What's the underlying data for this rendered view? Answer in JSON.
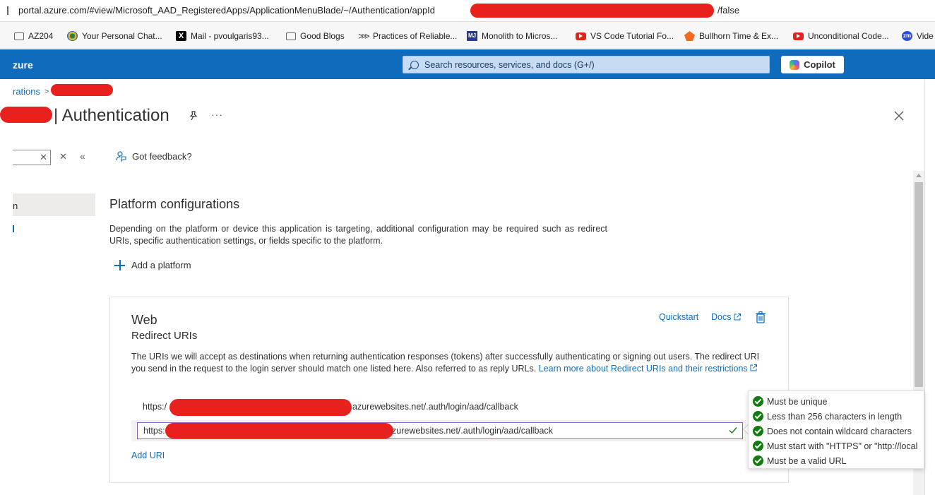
{
  "browser": {
    "url_start": "portal.azure.com/#view/Microsoft_AAD_RegisteredApps/ApplicationMenuBlade/~/Authentication/appId",
    "url_end": "/false"
  },
  "bookmarks": [
    {
      "label": "AZ204",
      "icon": "folder-icon"
    },
    {
      "label": "Your Personal Chat...",
      "icon": "chat-icon"
    },
    {
      "label": "Mail - pvoulgaris93...",
      "icon": "x-icon"
    },
    {
      "label": "Good Blogs",
      "icon": "folder-icon"
    },
    {
      "label": "Practices of Reliable...",
      "icon": "link-icon"
    },
    {
      "label": "Monolith to Micros...",
      "icon": "mj-icon"
    },
    {
      "label": "VS Code Tutorial Fo...",
      "icon": "youtube-icon"
    },
    {
      "label": "Bullhorn Time & Ex...",
      "icon": "bullhorn-icon"
    },
    {
      "label": "Unconditional Code...",
      "icon": "youtube-icon"
    },
    {
      "label": "Vide",
      "icon": "zm-icon"
    }
  ],
  "topbar": {
    "brand": "zure",
    "search_placeholder": "Search resources, services, and docs (G+/)",
    "copilot_label": "Copilot"
  },
  "breadcrumb": {
    "parent": "rations"
  },
  "blade": {
    "title": "| Authentication"
  },
  "leftnav": {
    "active_item": "n"
  },
  "toolbar": {
    "feedback_label": "Got feedback?"
  },
  "platform": {
    "heading": "Platform configurations",
    "description": "Depending on the platform or device this application is targeting, additional configuration may be required such as redirect URIs, specific authentication settings, or fields specific to the platform.",
    "add_label": "Add a platform"
  },
  "web_card": {
    "title": "Web",
    "subtitle": "Redirect URIs",
    "quickstart_label": "Quickstart",
    "docs_label": "Docs",
    "description": "The URIs we will accept as destinations when returning authentication responses (tokens) after successfully authenticating or signing out users. The redirect URI you send in the request to the login server should match one listed here. Also referred to as reply URLs.",
    "learn_more": "Learn more about Redirect URIs and their restrictions",
    "uri1_prefix": "https:/",
    "uri1_suffix": "azurewebsites.net/.auth/login/aad/callback",
    "uri2_prefix": "https:",
    "uri2_suffix": "zurewebsites.net/.auth/login/aad/callback",
    "add_uri_label": "Add URI"
  },
  "validation": [
    "Must be unique",
    "Less than 256 characters in length",
    "Does not contain wildcard characters",
    "Must start with \"HTTPS\" or \"http://local",
    "Must be a valid URL"
  ],
  "colors": {
    "azure_blue": "#0f6cbd",
    "success_green": "#107c10",
    "redaction": "#e8211f"
  }
}
